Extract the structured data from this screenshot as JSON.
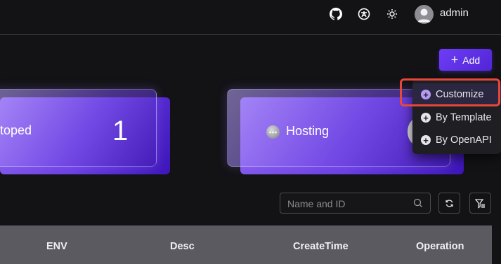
{
  "header": {
    "icons": [
      "github-icon",
      "translate-icon",
      "theme-sun-icon"
    ],
    "username": "admin"
  },
  "toolbar": {
    "add_label": "Add"
  },
  "cards": [
    {
      "title": "toped",
      "count": "1"
    },
    {
      "title": "Hosting"
    }
  ],
  "add_menu": {
    "items": [
      {
        "label": "Customize",
        "active": true
      },
      {
        "label": "By Template",
        "active": false
      },
      {
        "label": "By OpenAPI",
        "active": false
      }
    ]
  },
  "filter": {
    "search_placeholder": "Name and ID"
  },
  "table": {
    "columns": [
      "ENV",
      "Desc",
      "CreateTime",
      "Operation"
    ]
  },
  "colors": {
    "accent": "#6d3df5",
    "highlight_border": "#e8473c",
    "background": "#131316"
  }
}
